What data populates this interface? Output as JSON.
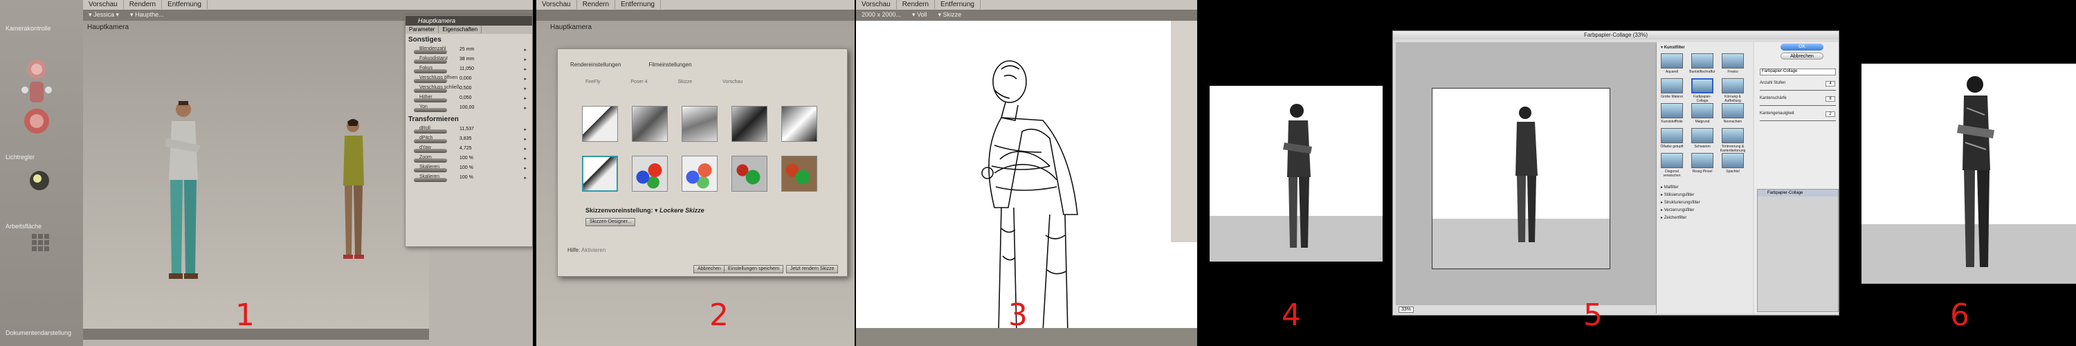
{
  "panel_numbers": [
    "1",
    "2",
    "3",
    "4",
    "5",
    "6"
  ],
  "panel1": {
    "tabs": [
      "Vorschau",
      "Rendern",
      "Entfernung"
    ],
    "toolbar": [
      "▾ Jessica ▾",
      "▾ Haupthe..."
    ],
    "viewport_label": "Hauptkamera",
    "left_controls": [
      "Kamerakontrolle",
      "Lichtregler",
      "Arbeitsfläche",
      "Dokumentendarstellung"
    ],
    "properties": {
      "header": "Hauptkamera",
      "tabs": [
        "Parameter",
        "Eigenschaften"
      ],
      "sections": [
        {
          "title": "Sonstiges",
          "rows": [
            {
              "label": "Blendenzahl",
              "value": "25 mm"
            },
            {
              "label": "Fokusdistanz",
              "value": "38 mm"
            },
            {
              "label": "Fokus",
              "value": "11,050"
            },
            {
              "label": "Verschluss öffnen",
              "value": "0,000"
            },
            {
              "label": "Verschluss schließ.",
              "value": "0,500"
            },
            {
              "label": "Hither",
              "value": "0,050"
            },
            {
              "label": "Yon",
              "value": "100,00"
            }
          ]
        },
        {
          "title": "Transformieren",
          "rows": [
            {
              "label": "dRoll",
              "value": "11,537"
            },
            {
              "label": "dPitch",
              "value": "3,835"
            },
            {
              "label": "dYaw",
              "value": "4,725"
            },
            {
              "label": "Zoom",
              "value": "100 %"
            },
            {
              "label": "Skalieren",
              "value": "100 %"
            },
            {
              "label": "Skalieren",
              "value": "100 %"
            }
          ]
        }
      ]
    }
  },
  "panel2": {
    "tabs": [
      "Vorschau",
      "Rendern",
      "Entfernung"
    ],
    "viewport_label": "Hauptkamera",
    "dialog": {
      "tabs": [
        "Rendereinstellungen",
        "Filmeinstellungen"
      ],
      "subtabs": [
        "FireFly",
        "Poser 4",
        "Skizze",
        "Vorschau"
      ],
      "skizze_label": "Skizzenvoreinstellung:",
      "skizze_value": "Lockere Skizze",
      "designer_button": "Skizzen-Designer...",
      "help_label": "Hilfe:",
      "help_value": "Aktivieren",
      "buttons": [
        "Abbrechen",
        "Einstellungen speichern",
        "Jetzt rendern Skizze"
      ]
    }
  },
  "panel3": {
    "tabs": [
      "Vorschau",
      "Rendern",
      "Entfernung"
    ],
    "toolbar": [
      "2000 x 2000...",
      "▾ Voll",
      "▾ Skizze"
    ]
  },
  "panel5": {
    "title": "Farbpapier-Collage (33%)",
    "zoom": "33%",
    "category_open": "Kunstfilter",
    "filters": [
      "Aquarell",
      "Buntstiftschraffur",
      "Fresko",
      "Grobe Malerei",
      "Farbpapier-Collage",
      "Körnung & Aufhellung",
      "Kunststofffolie",
      "Malgrund",
      "Neonschein",
      "Ölfarbe getupft",
      "Schwamm",
      "Tontrennung & Kantenbetonung",
      "Diagonal verwischen",
      "Rissig-Pinsel",
      "Spachtel"
    ],
    "categories": [
      "Malfilter",
      "Stilisierungsfilter",
      "Strukturierungsfilter",
      "Verzerrungsfilter",
      "Zeichenfilter"
    ],
    "ok": "OK",
    "cancel": "Abbrechen",
    "selected_filter": "Farbpapier-Collage",
    "settings": [
      {
        "label": "Anzahl Stufen",
        "value": "4"
      },
      {
        "label": "Kantenschärfe",
        "value": "8"
      },
      {
        "label": "Kantengenauigkeit",
        "value": "2"
      }
    ],
    "layer_name": "Farbpapier-Collage"
  }
}
